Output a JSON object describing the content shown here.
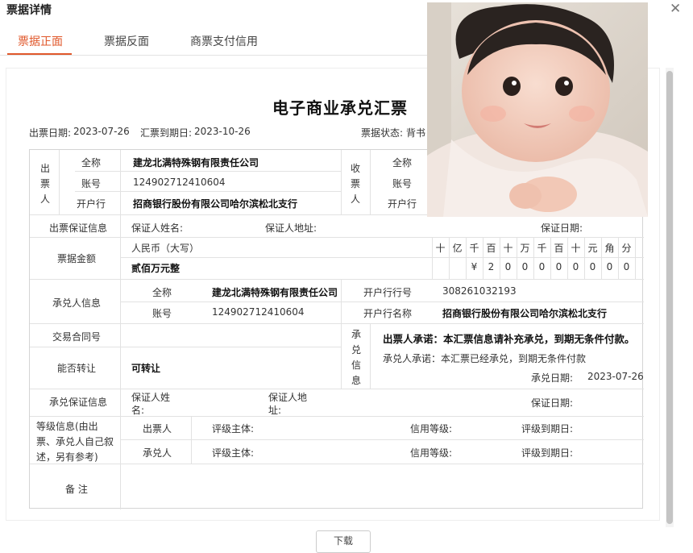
{
  "dialog": {
    "title": "票据详情"
  },
  "tabs": [
    {
      "label": "票据正面",
      "active": true
    },
    {
      "label": "票据反面",
      "active": false
    },
    {
      "label": "商票支付信用",
      "active": false
    }
  ],
  "bill": {
    "title": "电子商业承兑汇票",
    "issue_date_label": "出票日期:",
    "issue_date": "2023-07-26",
    "due_date_label": "汇票到期日:",
    "due_date": "2023-10-26",
    "status_label": "票据状态:",
    "status_value": "背书"
  },
  "drawer": {
    "section": [
      "出",
      "票",
      "人"
    ],
    "name_label": "全称",
    "name": "建龙北满特殊钢有限责任公司",
    "account_label": "账号",
    "account": "124902712410604",
    "bank_label": "开户行",
    "bank": "招商银行股份有限公司哈尔滨松北支行"
  },
  "payee": {
    "section": [
      "收",
      "票",
      "人"
    ],
    "name_label": "全称",
    "account_label": "账号",
    "bank_label": "开户行"
  },
  "issue_guarantee": {
    "label": "出票保证信息",
    "name_label": "保证人姓名:",
    "address_label": "保证人地址:",
    "date_label": "保证日期:"
  },
  "amount": {
    "label": "票据金额",
    "currency_label": "人民币（大写）",
    "words": "贰佰万元整",
    "units": [
      "十",
      "亿",
      "千",
      "百",
      "十",
      "万",
      "千",
      "百",
      "十",
      "元",
      "角",
      "分"
    ],
    "digits": [
      "",
      "",
      "¥",
      "2",
      "0",
      "0",
      "0",
      "0",
      "0",
      "0",
      "0",
      "0"
    ]
  },
  "acceptor": {
    "label": "承兑人信息",
    "name_label": "全称",
    "name": "建龙北满特殊钢有限责任公司",
    "account_label": "账号",
    "account": "124902712410604",
    "bank_no_label": "开户行行号",
    "bank_no": "308261032193",
    "bank_name_label": "开户行名称",
    "bank_name": "招商银行股份有限公司哈尔滨松北支行"
  },
  "contract": {
    "label": "交易合同号"
  },
  "transferable": {
    "label": "能否转让",
    "value": "可转让"
  },
  "acceptance": {
    "section": [
      "承",
      "兑",
      "信",
      "息"
    ],
    "drawer_promise": "出票人承诺：本汇票信息请补充承兑，到期无条件付款。",
    "acceptor_promise": "承兑人承诺：本汇票已经承兑，到期无条件付款",
    "date_label": "承兑日期:",
    "date": "2023-07-26"
  },
  "accept_guarantee": {
    "label": "承兑保证信息",
    "name_label_1": "保证人姓",
    "name_label_2": "名:",
    "address_label_1": "保证人地",
    "address_label_2": "址:",
    "date_label": "保证日期:"
  },
  "rating": {
    "label_lines": [
      "等级信息(由出",
      "票、承兑人自己叙",
      "述，另有参考)"
    ],
    "drawer_label": "出票人",
    "acceptor_label": "承兑人",
    "subject_label": "评级主体:",
    "credit_label": "信用等级:",
    "expiry_label": "评级到期日:"
  },
  "remarks": {
    "label": "备 注"
  },
  "actions": {
    "download_label": "下载"
  },
  "colors": {
    "accent": "#e0582b",
    "border": "#e2e2e2"
  }
}
